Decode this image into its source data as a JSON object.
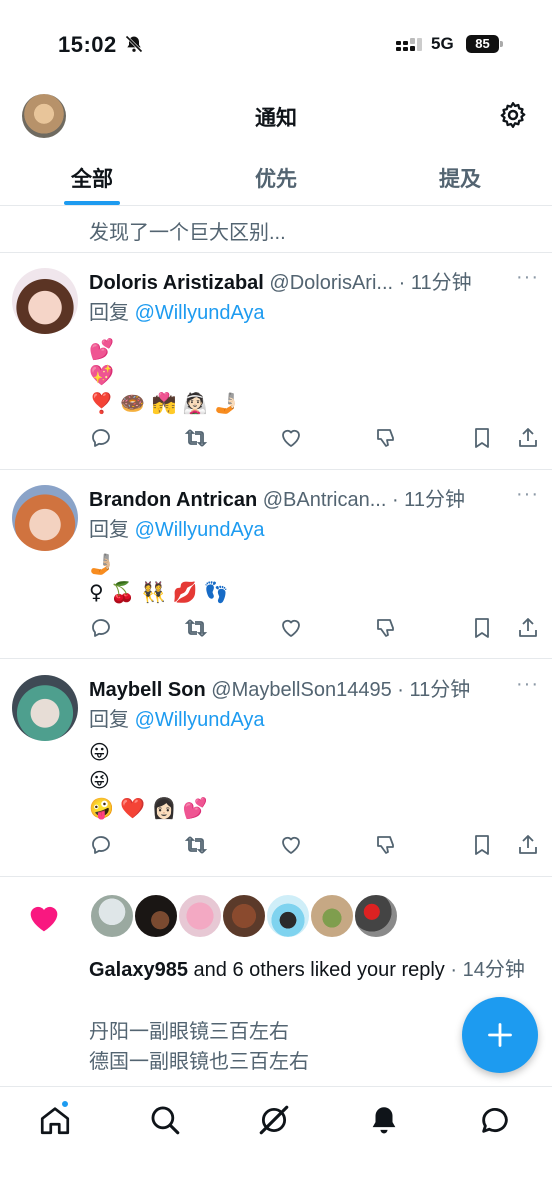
{
  "status_bar": {
    "time": "15:02",
    "network": "5G",
    "battery": "85"
  },
  "header": {
    "title": "通知"
  },
  "tabs": [
    {
      "label": "全部",
      "active": true
    },
    {
      "label": "优先",
      "active": false
    },
    {
      "label": "提及",
      "active": false
    }
  ],
  "truncated_post": {
    "text": "发现了一个巨大区别..."
  },
  "posts": [
    {
      "name": "Doloris Aristizabal",
      "handle": "@DolorisAri...",
      "time": "· 11分钟",
      "more": "···",
      "reply_prefix": "回复 ",
      "reply_to": "@WillyundAya",
      "emoji_lines": [
        "💕",
        "💖",
        "❣️ 🍩 💏 👰🏻 🤳🏻"
      ]
    },
    {
      "name": "Brandon Antrican",
      "handle": "@BAntrican...",
      "time": "· 11分钟",
      "more": "···",
      "reply_prefix": "回复 ",
      "reply_to": "@WillyundAya",
      "emoji_lines": [
        "🤳🏼",
        "♀ 🍒 👯 💋 👣"
      ]
    },
    {
      "name": "Maybell Son",
      "handle": "@MaybellSon14495",
      "time": "· 11分钟",
      "more": "···",
      "reply_prefix": "回复 ",
      "reply_to": "@WillyundAya",
      "emoji_lines": [
        "😛",
        "😜",
        "🤪 ❤️ 👩🏻 💕"
      ]
    }
  ],
  "like_notification": {
    "who": "Galaxy985",
    "rest": " and 6 others liked your reply",
    "time": " · 14分钟",
    "quote_lines": [
      "丹阳一副眼镜三百左右",
      "德国一副眼镜也三百左右"
    ]
  },
  "colors": {
    "accent": "#1d9bf0",
    "like": "#f91880",
    "text": "#0f1419",
    "secondary": "#536471"
  },
  "bottom_nav": [
    "home-icon",
    "search-icon",
    "grok-icon",
    "notifications-icon",
    "messages-icon"
  ]
}
